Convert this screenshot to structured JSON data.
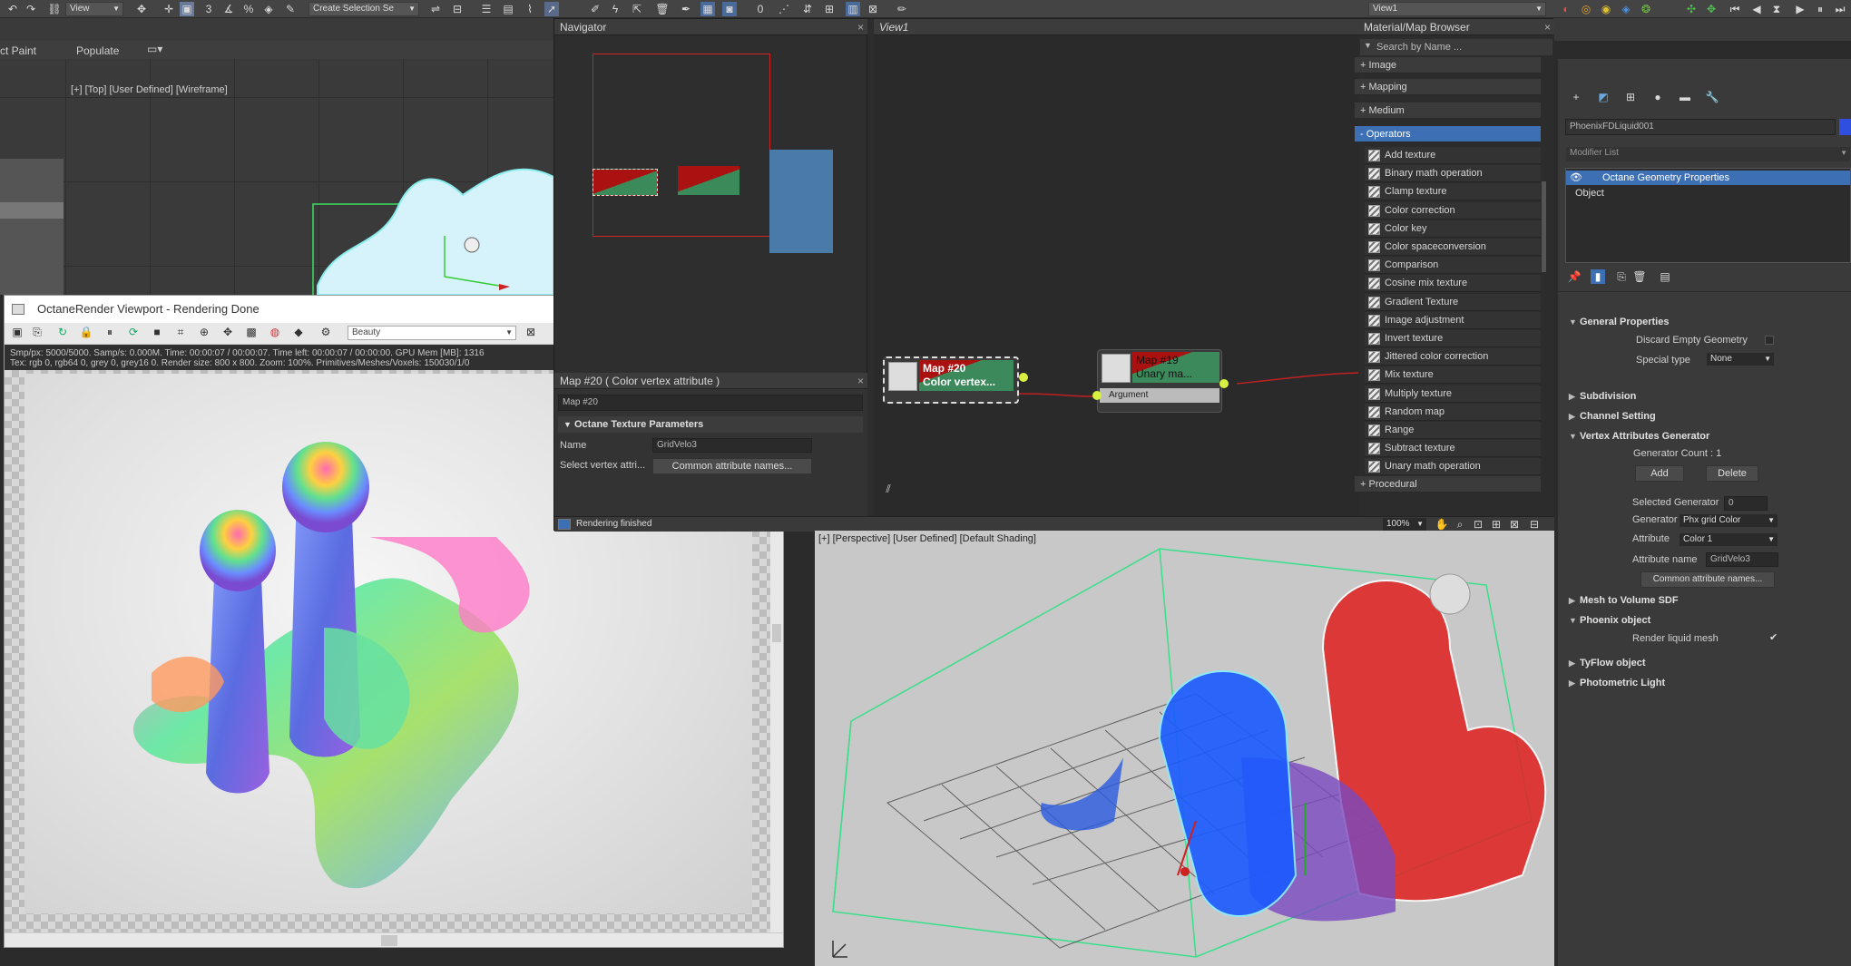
{
  "toolbar": {
    "view_label": "View",
    "selection_set_label": "Create Selection Se",
    "view_dropdown_right": "View1"
  },
  "ribbon": {
    "paint_label": "ct Paint",
    "populate_label": "Populate"
  },
  "top_viewport": {
    "label": "[+] [Top] [User Defined] [Wireframe]"
  },
  "octane": {
    "title": "OctaneRender Viewport - Rendering Done",
    "mode": "Beauty",
    "stats_line1": "Smp/px: 5000/5000.   Samp/s: 0.000M.   Time: 00:00:07 / 00:00:07.   Time left: 00:00:07 / 00:00:00.   GPU Mem [MB]: 1316",
    "stats_line2": "Tex: rgb 0, rgb64 0, grey 0, grey16 0.   Render size: 800 x 800.   Zoom: 100%.   Primitives/Meshes/Voxels: 150030/1/0"
  },
  "navigator": {
    "title": "Navigator"
  },
  "view1": {
    "title": "View1",
    "node1_title": "Map #20",
    "node1_sub": "Color vertex...",
    "node2_title": "Map #19",
    "node2_sub": "Unary ma...",
    "node2_slot": "Argument",
    "zoom": "100%"
  },
  "param_editor": {
    "title": "Map #20  ( Color vertex attribute )",
    "map_name": "Map #20",
    "rollout": "Octane Texture Parameters",
    "name_label": "Name",
    "name_value": "GridVelo3",
    "select_label": "Select vertex attri...",
    "common_btn": "Common attribute names..."
  },
  "status": {
    "text": "Rendering finished"
  },
  "mmb": {
    "title": "Material/Map Browser",
    "search_placeholder": "Search by Name ...",
    "groups_top": [
      "+ Image",
      "+ Mapping",
      "+ Medium"
    ],
    "operators": "- Operators",
    "items": [
      "Add texture",
      "Binary math operation",
      "Clamp texture",
      "Color correction",
      "Color key",
      "Color spaceconversion",
      "Comparison",
      "Cosine mix texture",
      "Gradient Texture",
      "Image adjustment",
      "Invert texture",
      "Jittered color correction",
      "Mix texture",
      "Multiply texture",
      "Random map",
      "Range",
      "Subtract texture",
      "Unary math operation"
    ],
    "procedural": "+ Procedural"
  },
  "command_panel": {
    "object_name": "PhoenixFDLiquid001",
    "modifier_list": "Modifier List",
    "stack": [
      "Octane Geometry Properties",
      "Object"
    ],
    "general_properties": "General Properties",
    "discard_empty": "Discard Empty Geometry",
    "special_type_label": "Special type",
    "special_type_value": "None",
    "subdivision": "Subdivision",
    "channel_setting": "Channel Setting",
    "vag": "Vertex Attributes Generator",
    "generator_count": "Generator Count : 1",
    "add_btn": "Add",
    "delete_btn": "Delete",
    "selected_generator_label": "Selected Generator",
    "selected_generator_value": "0",
    "generator_label": "Generator",
    "generator_value": "Phx grid Color",
    "attribute_label": "Attribute",
    "attribute_value": "Color 1",
    "attribute_name_label": "Attribute name",
    "attribute_name_value": "GridVelo3",
    "common_names_btn": "Common attribute names...",
    "mesh_to_volume": "Mesh to Volume SDF",
    "phoenix_object": "Phoenix object",
    "render_liquid": "Render liquid mesh",
    "tyflow": "TyFlow object",
    "photometric": "Photometric Light"
  },
  "persp_viewport": {
    "label": "[+] [Perspective] [User Defined] [Default Shading]"
  },
  "colors": {
    "selection_blue": "#3d6fb5",
    "node_green": "#3c8a5c",
    "node_red": "#a31515",
    "wire_red": "#c02020",
    "socket_yellow": "#d8f040"
  }
}
